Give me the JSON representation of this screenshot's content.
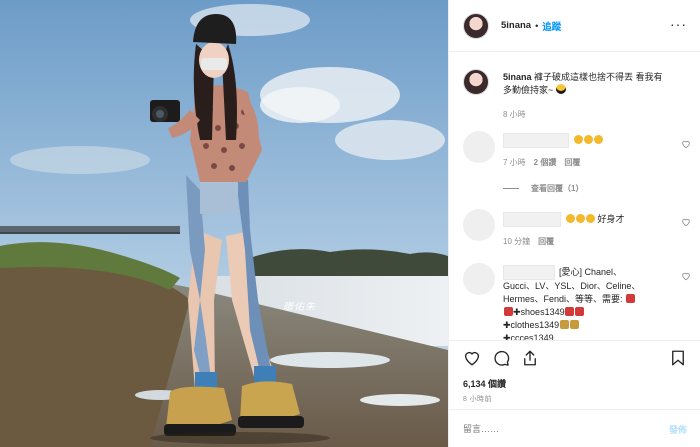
{
  "header": {
    "username": "5inana",
    "separator": "•",
    "follow_label": "追蹤",
    "more_label": "···"
  },
  "caption": {
    "username": "5inana",
    "text": "褲子破成這樣也捨不得丟 看我有多勤儉持家~",
    "time": "8 小時"
  },
  "comments": [
    {
      "text": "",
      "time": "7 小時",
      "likes": "2 個讚",
      "reply": "回覆",
      "view_replies": "查看回覆（1）"
    },
    {
      "text": "好身才",
      "time": "10 分鐘",
      "reply": "回覆"
    },
    {
      "text_lines": [
        "[愛心] Chanel、",
        "Gucci、LV、YSL、Dior、Celine、",
        "Hermes、Fendi、等等、需要:",
        "shoes1349",
        "clothes1349",
        "ccces1349"
      ]
    }
  ],
  "actions": {
    "views": "6,134 個讚",
    "time": "8 小時前"
  },
  "comment_box": {
    "placeholder": "留言……",
    "post_label": "發佈"
  },
  "colors": {
    "link": "#0095f6",
    "muted": "#8e8e8e",
    "border": "#efefef",
    "post_disabled": "#b2dffc"
  },
  "photo": {
    "watermark": "暻佑朱"
  }
}
